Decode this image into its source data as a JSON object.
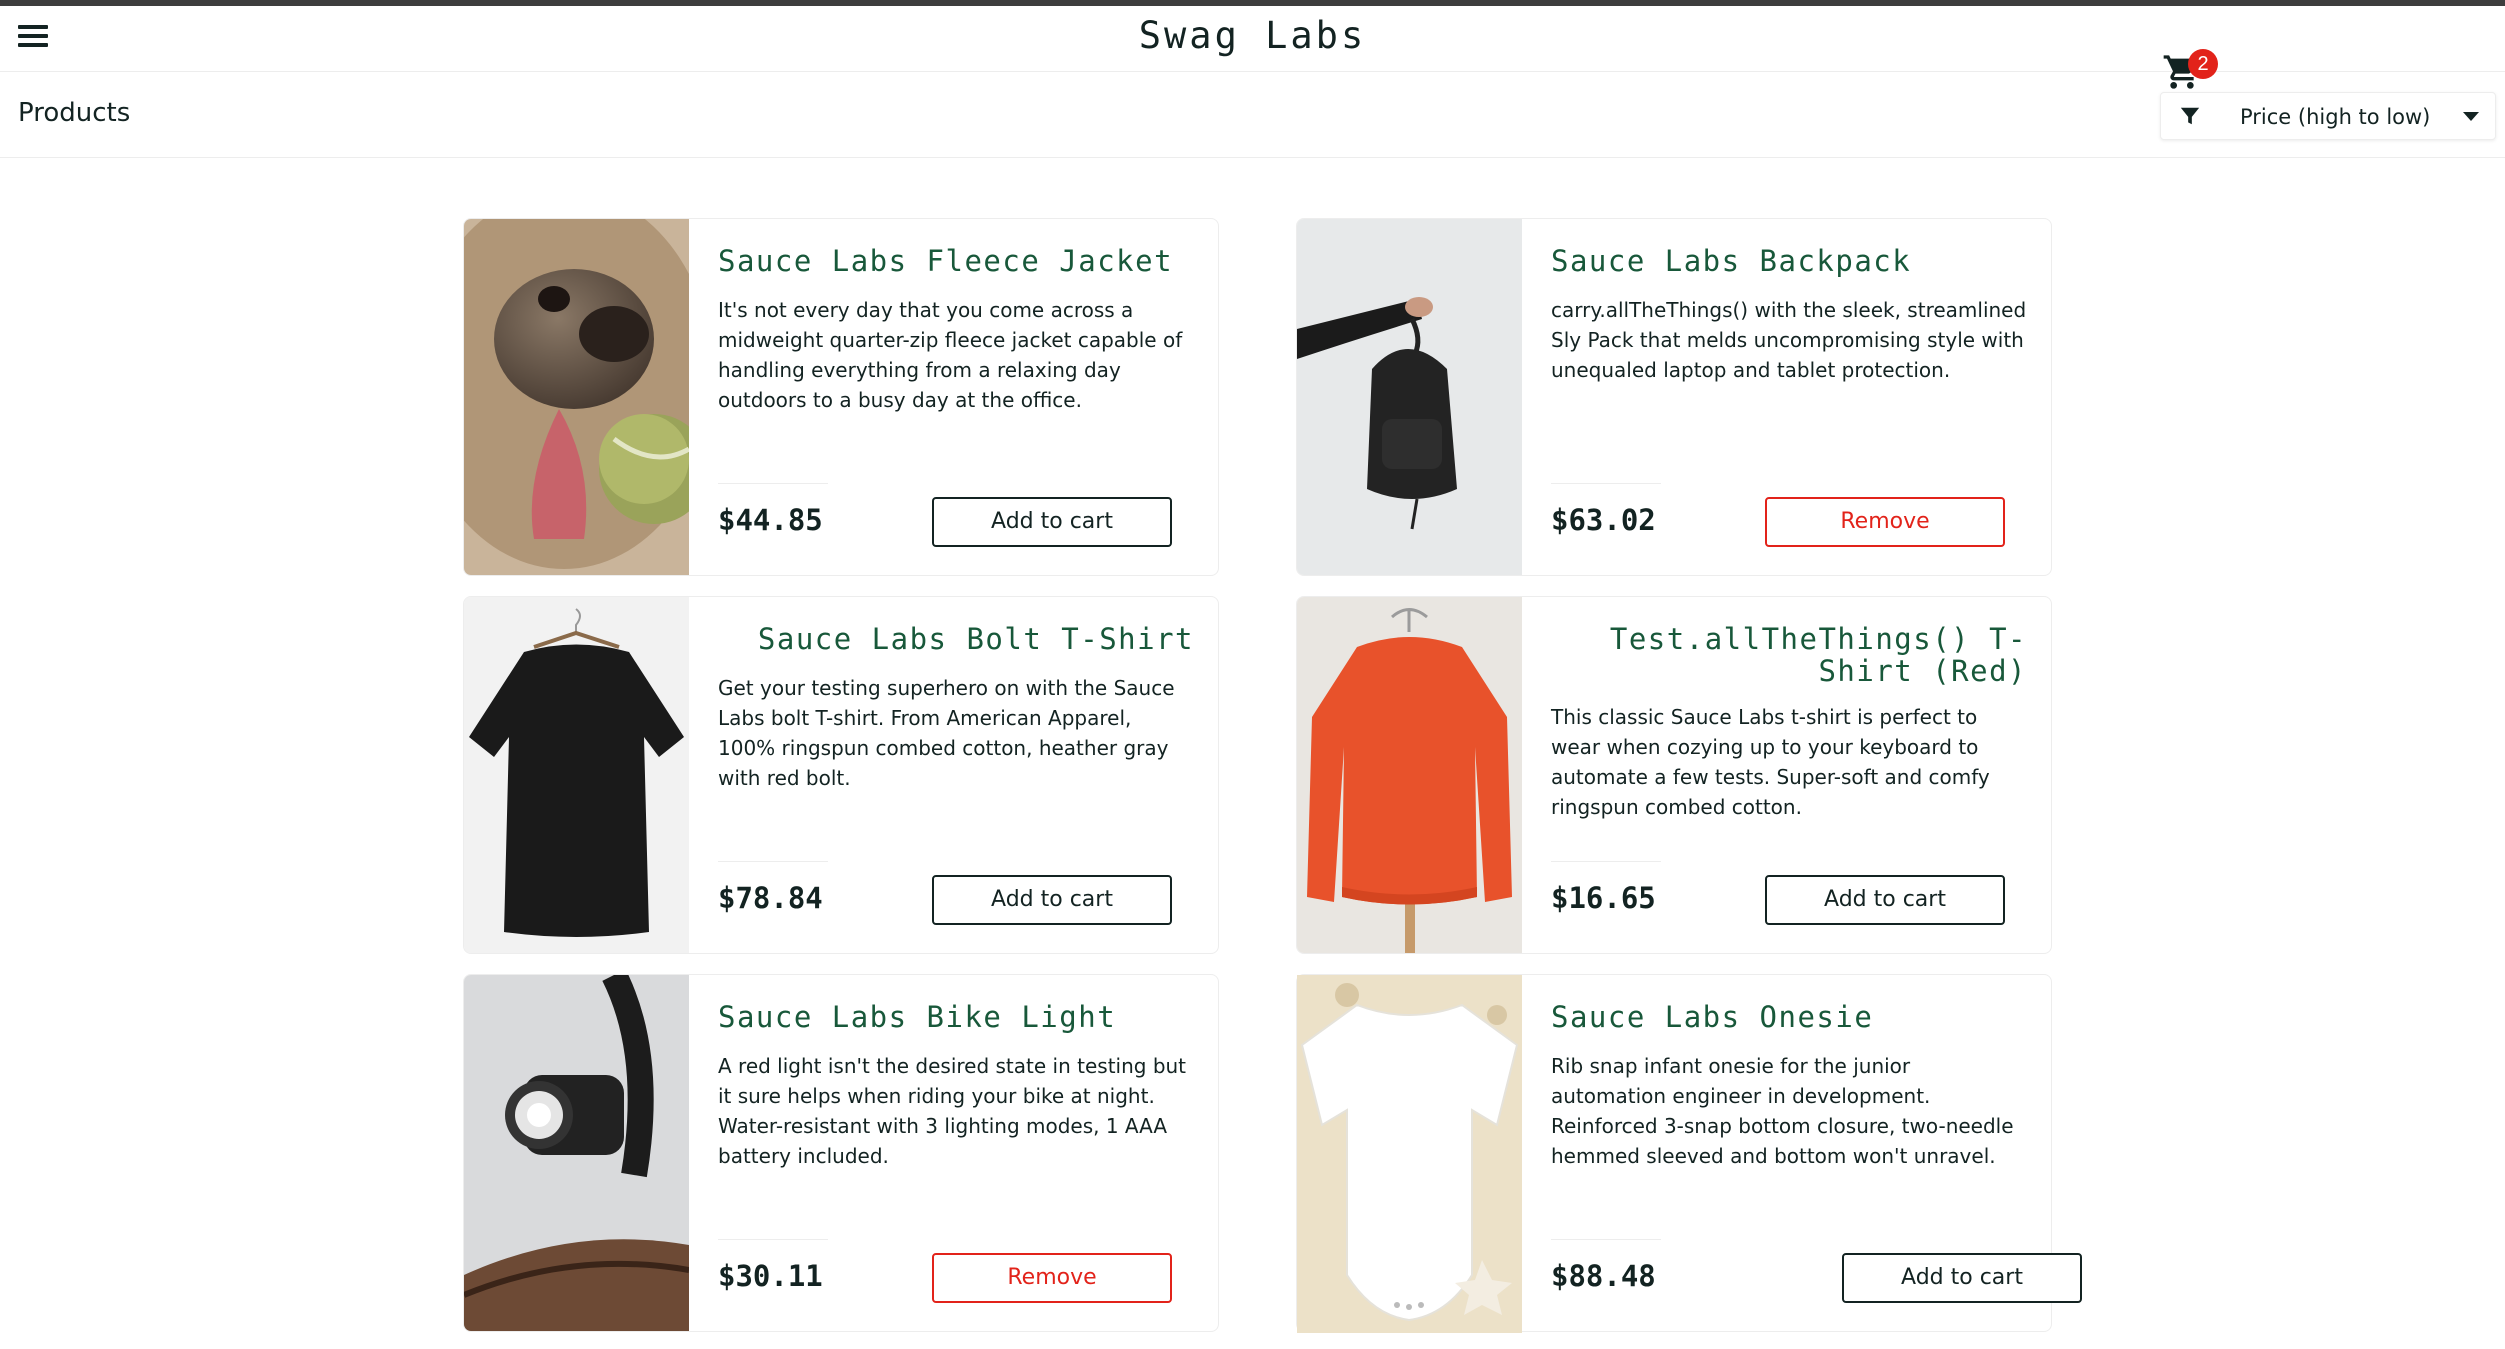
{
  "header": {
    "menu_icon": "hamburger-menu-icon",
    "logo": "Swag Labs",
    "cart_icon": "shopping-cart-icon",
    "cart_count": "2"
  },
  "subheader": {
    "title": "Products",
    "sort_icon": "filter-funnel-icon",
    "sort_selected": "Price (high to low)"
  },
  "colors": {
    "accent_green": "#18583a",
    "remove_red": "#e2231a",
    "text_dark": "#132322",
    "border": "#ededed"
  },
  "products": [
    {
      "name": "Sauce Labs Fleece Jacket",
      "description": "It's not every day that you come across a midweight quarter-zip fleece jacket capable of handling everything from a relaxing day outdoors to a busy day at the office.",
      "price": "$44.85",
      "button": "Add to cart",
      "in_cart": false
    },
    {
      "name": "Sauce Labs Backpack",
      "description": "carry.allTheThings() with the sleek, streamlined Sly Pack that melds uncompromising style with unequaled laptop and tablet protection.",
      "price": "$63.02",
      "button": "Remove",
      "in_cart": true
    },
    {
      "name": "Sauce Labs Bolt T-Shirt",
      "description": "Get your testing superhero on with the Sauce Labs bolt T-shirt. From American Apparel, 100% ringspun combed cotton, heather gray with red bolt.",
      "price": "$78.84",
      "button": "Add to cart",
      "in_cart": false
    },
    {
      "name": "Test.allTheThings() T-Shirt (Red)",
      "description": "This classic Sauce Labs t-shirt is perfect to wear when cozying up to your keyboard to automate a few tests. Super-soft and comfy ringspun combed cotton.",
      "price": "$16.65",
      "button": "Add to cart",
      "in_cart": false
    },
    {
      "name": "Sauce Labs Bike Light",
      "description": "A red light isn't the desired state in testing but it sure helps when riding your bike at night. Water-resistant with 3 lighting modes, 1 AAA battery included.",
      "price": "$30.11",
      "button": "Remove",
      "in_cart": true
    },
    {
      "name": "Sauce Labs Onesie",
      "description": "Rib snap infant onesie for the junior automation engineer in development. Reinforced 3-snap bottom closure, two-needle hemmed sleeved and bottom won't unravel.",
      "price": "$88.48",
      "button": "Add to cart",
      "in_cart": false
    }
  ]
}
